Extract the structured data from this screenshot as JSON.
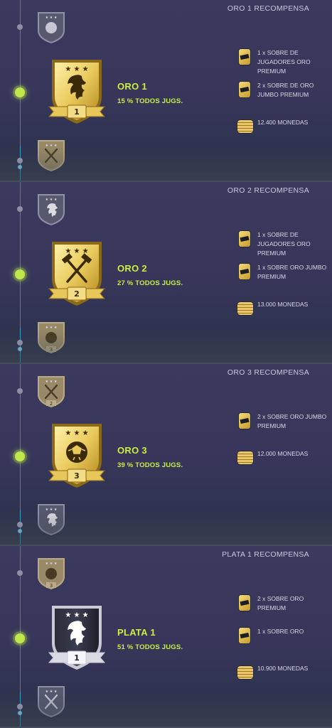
{
  "sections": [
    {
      "title": "ORO 1 RECOMPENSA",
      "rank_name": "ORO 1",
      "percent": "15 % TODOS JUGS.",
      "badge_number": "1",
      "badge_tier": "gold",
      "badge_emblem": "lion-icon",
      "small_top": {
        "tier": "silver",
        "emblem": "ball-icon",
        "number": ""
      },
      "small_bottom": {
        "tier": "gold",
        "emblem": "hammers-icon",
        "number": ""
      },
      "rewards": [
        {
          "icon": "pack-icon",
          "text": "1 x SOBRE DE JUGADORES ORO PREMIUM"
        },
        {
          "icon": "pack-icon",
          "text": "2 x SOBRE DE ORO JUMBO PREMIUM"
        },
        {
          "icon": "coins-icon",
          "text": "12.400 MONEDAS"
        }
      ]
    },
    {
      "title": "ORO 2 RECOMPENSA",
      "rank_name": "ORO 2",
      "percent": "27 % TODOS JUGS.",
      "badge_number": "2",
      "badge_tier": "gold",
      "badge_emblem": "hammers-icon",
      "small_top": {
        "tier": "silver",
        "emblem": "lion-icon",
        "number": ""
      },
      "small_bottom": {
        "tier": "gold",
        "emblem": "ball-icon",
        "number": "3"
      },
      "rewards": [
        {
          "icon": "pack-icon",
          "text": "1 x SOBRE DE JUGADORES ORO PREMIUM"
        },
        {
          "icon": "pack-icon",
          "text": "1 x SOBRE ORO JUMBO PREMIUM"
        },
        {
          "icon": "coins-icon",
          "text": "13.000 MONEDAS"
        }
      ]
    },
    {
      "title": "ORO 3 RECOMPENSA",
      "rank_name": "ORO 3",
      "percent": "39 % TODOS JUGS.",
      "badge_number": "3",
      "badge_tier": "gold",
      "badge_emblem": "ball-icon",
      "small_top": {
        "tier": "gold",
        "emblem": "hammers-icon",
        "number": "2"
      },
      "small_bottom": {
        "tier": "silver",
        "emblem": "lion-icon",
        "number": ""
      },
      "rewards": [
        {
          "icon": "pack-icon",
          "text": "2 x SOBRE ORO JUMBO PREMIUM"
        },
        {
          "icon": "coins-icon",
          "text": "12.000 MONEDAS"
        }
      ]
    },
    {
      "title": "PLATA 1 RECOMPENSA",
      "rank_name": "PLATA 1",
      "percent": "51 % TODOS JUGS.",
      "badge_number": "1",
      "badge_tier": "silver",
      "badge_emblem": "lion-icon",
      "small_top": {
        "tier": "gold",
        "emblem": "ball-icon",
        "number": "3"
      },
      "small_bottom": {
        "tier": "silver",
        "emblem": "hammers-icon",
        "number": ""
      },
      "rewards": [
        {
          "icon": "pack-icon",
          "text": "2 x SOBRE ORO PREMIUM"
        },
        {
          "icon": "pack-icon",
          "text": "1 x SOBRE ORO"
        },
        {
          "icon": "coins-icon",
          "text": "10.900 MONEDAS"
        }
      ]
    }
  ],
  "colors": {
    "accent": "#c9ef3f",
    "gold_light": "#f6e58a",
    "gold_dark": "#b3891f",
    "silver_light": "#ffffff",
    "silver_dark": "#20222e"
  }
}
